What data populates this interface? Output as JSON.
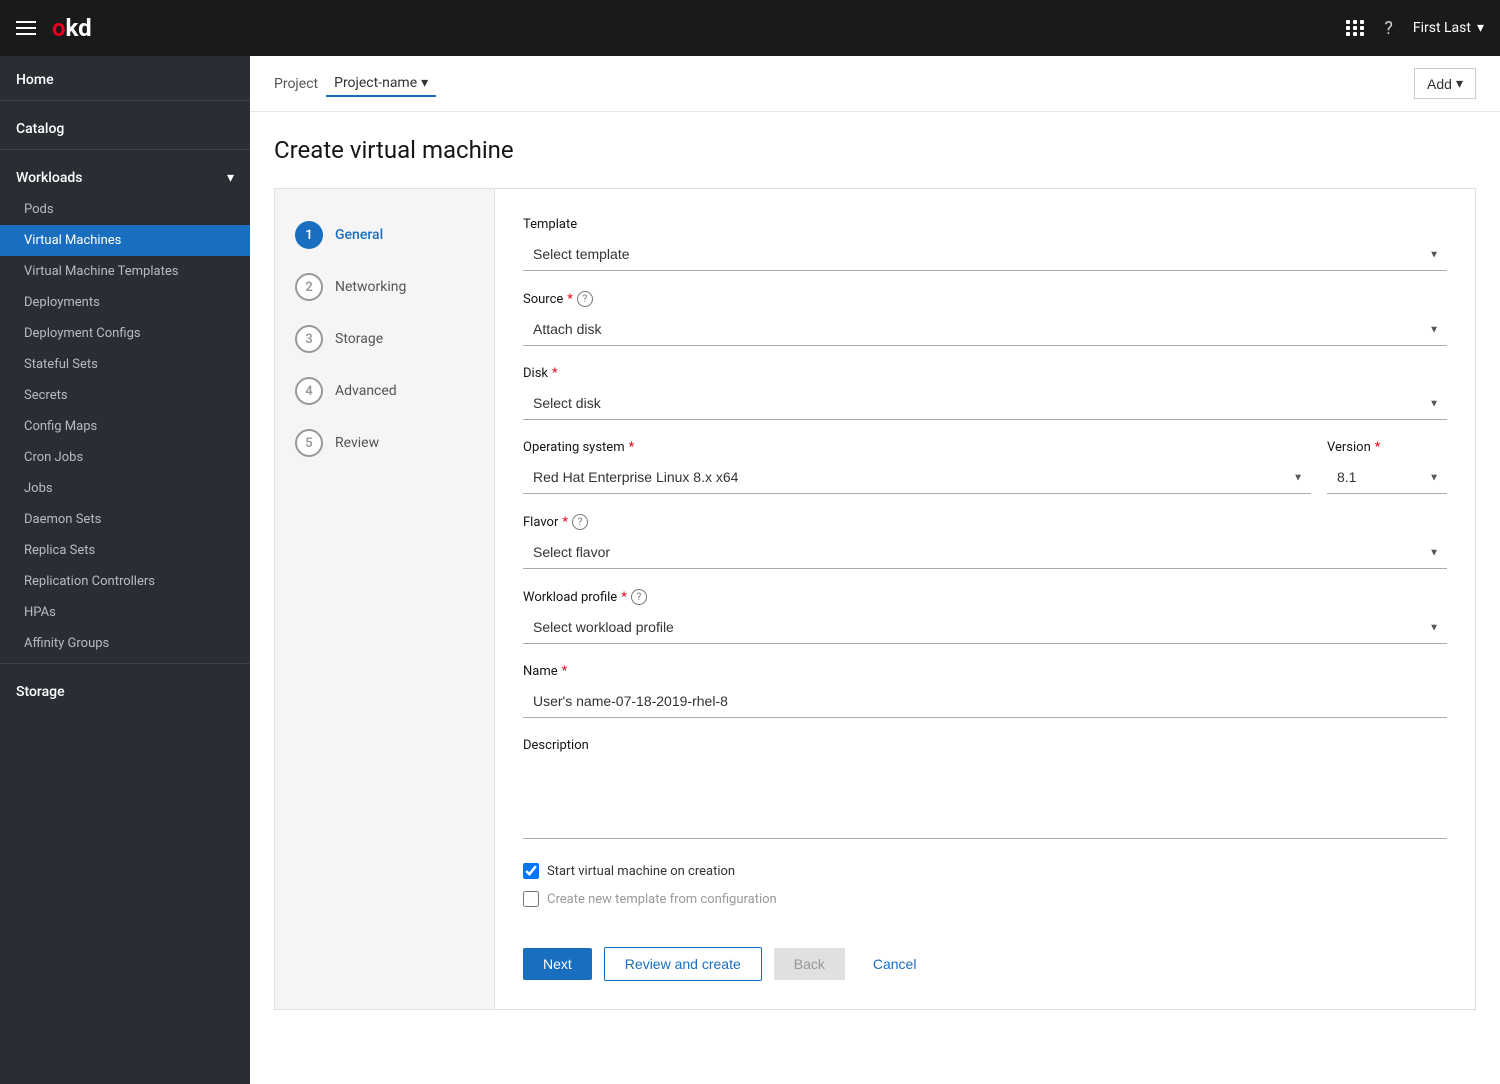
{
  "topnav": {
    "logo_o": "o",
    "logo_kd": "kd",
    "user_label": "First Last"
  },
  "sidebar": {
    "sections": [
      {
        "id": "home",
        "label": "Home",
        "items": []
      },
      {
        "id": "catalog",
        "label": "Catalog",
        "items": []
      },
      {
        "id": "workloads",
        "label": "Workloads",
        "expandable": true,
        "items": [
          {
            "id": "pods",
            "label": "Pods",
            "active": false
          },
          {
            "id": "virtual-machines",
            "label": "Virtual Machines",
            "active": true
          },
          {
            "id": "virtual-machine-templates",
            "label": "Virtual Machine Templates",
            "active": false
          },
          {
            "id": "deployments",
            "label": "Deployments",
            "active": false
          },
          {
            "id": "deployment-configs",
            "label": "Deployment Configs",
            "active": false
          },
          {
            "id": "stateful-sets",
            "label": "Stateful Sets",
            "active": false
          },
          {
            "id": "secrets",
            "label": "Secrets",
            "active": false
          },
          {
            "id": "config-maps",
            "label": "Config Maps",
            "active": false
          },
          {
            "id": "cron-jobs",
            "label": "Cron Jobs",
            "active": false
          },
          {
            "id": "jobs",
            "label": "Jobs",
            "active": false
          },
          {
            "id": "daemon-sets",
            "label": "Daemon Sets",
            "active": false
          },
          {
            "id": "replica-sets",
            "label": "Replica Sets",
            "active": false
          },
          {
            "id": "replication-controllers",
            "label": "Replication Controllers",
            "active": false
          },
          {
            "id": "hpas",
            "label": "HPAs",
            "active": false
          },
          {
            "id": "affinity-groups",
            "label": "Affinity Groups",
            "active": false
          }
        ]
      },
      {
        "id": "storage",
        "label": "Storage",
        "items": []
      }
    ]
  },
  "project_bar": {
    "project_label": "Project",
    "project_name": "Project-name",
    "add_label": "Add"
  },
  "page": {
    "title": "Create virtual machine"
  },
  "wizard": {
    "steps": [
      {
        "num": "1",
        "label": "General",
        "active": true
      },
      {
        "num": "2",
        "label": "Networking",
        "active": false
      },
      {
        "num": "3",
        "label": "Storage",
        "active": false
      },
      {
        "num": "4",
        "label": "Advanced",
        "active": false
      },
      {
        "num": "5",
        "label": "Review",
        "active": false
      }
    ],
    "form": {
      "template_label": "Template",
      "template_placeholder": "Select template",
      "source_label": "Source",
      "source_value": "Attach disk",
      "disk_label": "Disk",
      "disk_placeholder": "Select disk",
      "os_label": "Operating system",
      "os_value": "Red Hat Enterprise Linux 8.x x64",
      "version_label": "Version",
      "version_value": "8.1",
      "flavor_label": "Flavor",
      "flavor_placeholder": "Select flavor",
      "workload_label": "Workload profile",
      "workload_placeholder": "Select workload profile",
      "name_label": "Name",
      "name_value": "User's name-07-18-2019-rhel-8",
      "description_label": "Description",
      "checkbox_start_label": "Start virtual machine on creation",
      "checkbox_template_label": "Create new template from configuration"
    },
    "actions": {
      "next_label": "Next",
      "review_create_label": "Review and create",
      "back_label": "Back",
      "cancel_label": "Cancel"
    }
  }
}
